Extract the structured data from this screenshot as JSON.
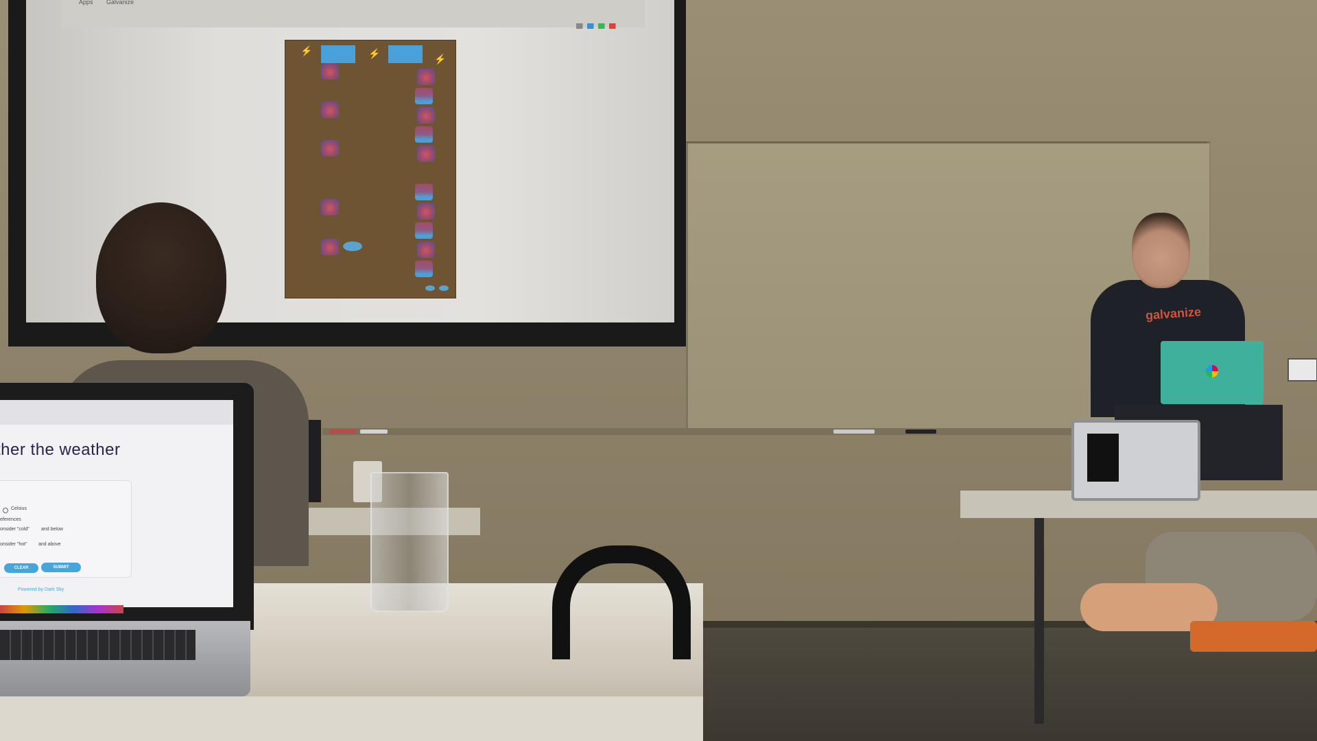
{
  "projector": {
    "browser_bar": [
      "Apps",
      "Galvanize"
    ]
  },
  "presenter": {
    "shirt_logo": "galvanize"
  },
  "laptop": {
    "heading": "ther the weather",
    "radio_option": "Celsius",
    "section_label": "eferences",
    "cold_label": "onsider \"cold\"",
    "cold_suffix": "and below",
    "hot_label": "onsider \"hot\"",
    "hot_suffix": "and above",
    "clear_button": "CLEAR",
    "submit_button": "SUBMIT",
    "footer": "Powered by Dark Sky"
  },
  "colors": {
    "wall": "#9a8f74",
    "game_board": "#6e5432",
    "goal_blue": "#4aa1d9",
    "accent_button": "#46a6dc",
    "laptop_green": "#3fb09b"
  }
}
